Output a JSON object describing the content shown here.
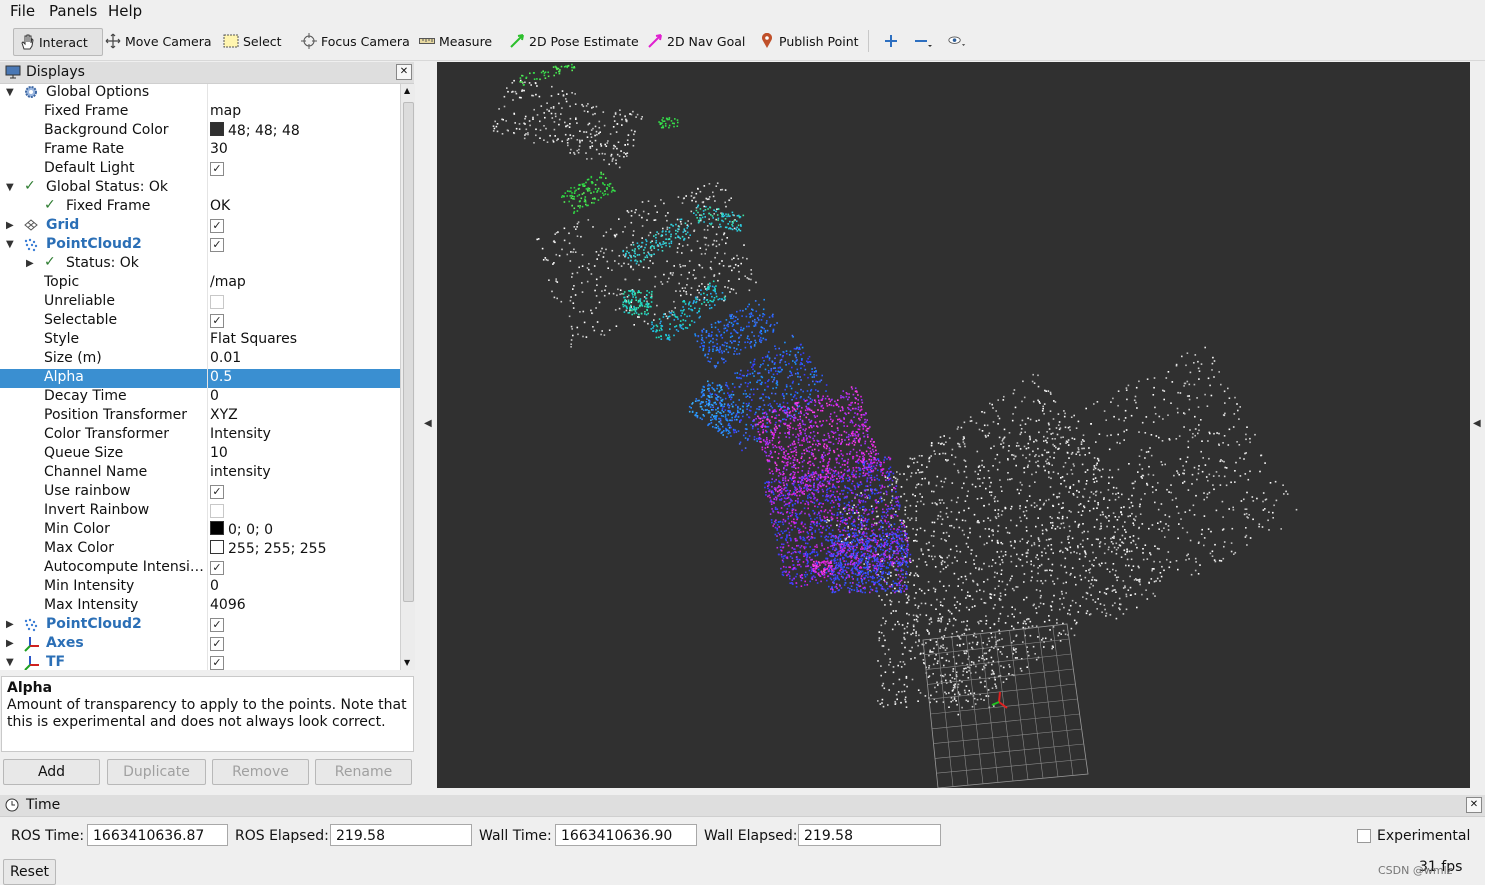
{
  "menu": [
    "File",
    "Panels",
    "Help"
  ],
  "toolbar": {
    "interact": "Interact",
    "move_camera": "Move Camera",
    "select": "Select",
    "focus_camera": "Focus Camera",
    "measure": "Measure",
    "pose_estimate": "2D Pose Estimate",
    "nav_goal": "2D Nav Goal",
    "publish_point": "Publish Point"
  },
  "displays": {
    "title": "Displays",
    "rows": [
      {
        "label": "Global Options",
        "value": ""
      },
      {
        "label": "Fixed Frame",
        "value": "map"
      },
      {
        "label": "Background Color",
        "value": "48; 48; 48"
      },
      {
        "label": "Frame Rate",
        "value": "30"
      },
      {
        "label": "Default Light",
        "value": ""
      },
      {
        "label": "Global Status: Ok",
        "value": ""
      },
      {
        "label": "Fixed Frame",
        "value": "OK"
      },
      {
        "label": "Grid",
        "value": ""
      },
      {
        "label": "PointCloud2",
        "value": ""
      },
      {
        "label": "Status: Ok",
        "value": ""
      },
      {
        "label": "Topic",
        "value": "/map"
      },
      {
        "label": "Unreliable",
        "value": ""
      },
      {
        "label": "Selectable",
        "value": ""
      },
      {
        "label": "Style",
        "value": "Flat Squares"
      },
      {
        "label": "Size (m)",
        "value": "0.01"
      },
      {
        "label": "Alpha",
        "value": "0.5"
      },
      {
        "label": "Decay Time",
        "value": "0"
      },
      {
        "label": "Position Transformer",
        "value": "XYZ"
      },
      {
        "label": "Color Transformer",
        "value": "Intensity"
      },
      {
        "label": "Queue Size",
        "value": "10"
      },
      {
        "label": "Channel Name",
        "value": "intensity"
      },
      {
        "label": "Use rainbow",
        "value": ""
      },
      {
        "label": "Invert Rainbow",
        "value": ""
      },
      {
        "label": "Min Color",
        "value": "0; 0; 0"
      },
      {
        "label": "Max Color",
        "value": "255; 255; 255"
      },
      {
        "label": "Autocompute Intensi…",
        "value": ""
      },
      {
        "label": "Min Intensity",
        "value": "0"
      },
      {
        "label": "Max Intensity",
        "value": "4096"
      },
      {
        "label": "PointCloud2",
        "value": ""
      },
      {
        "label": "Axes",
        "value": ""
      },
      {
        "label": "TF",
        "value": ""
      }
    ],
    "description_title": "Alpha",
    "description_text": "Amount of transparency to apply to the points. Note that this is experimental and does not always look correct.",
    "buttons": {
      "add": "Add",
      "duplicate": "Duplicate",
      "remove": "Remove",
      "rename": "Rename"
    }
  },
  "colors": {
    "background": "#303030",
    "selection": "#3a8fd1",
    "display_name": "#2b6fb6",
    "ok_check": "#2e7d32"
  },
  "time": {
    "title": "Time",
    "ros_time_label": "ROS Time:",
    "ros_time": "1663410636.87",
    "ros_elapsed_label": "ROS Elapsed:",
    "ros_elapsed": "219.58",
    "wall_time_label": "Wall Time:",
    "wall_time": "1663410636.90",
    "wall_elapsed_label": "Wall Elapsed:",
    "wall_elapsed": "219.58",
    "experimental": "Experimental",
    "reset": "Reset",
    "fps": "31 fps",
    "watermark": "CSDN @wmlz"
  }
}
